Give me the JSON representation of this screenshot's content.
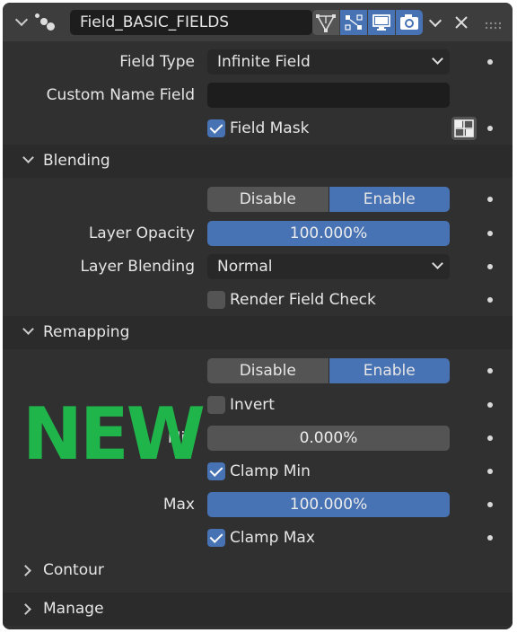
{
  "header": {
    "name_value": "Field_BASIC_FIELDS",
    "icons": [
      "modifier-dots-icon",
      "node-tree-icon",
      "edit-mode-icon",
      "realtime-monitor-icon",
      "camera-render-icon"
    ]
  },
  "rows": {
    "field_type_label": "Field Type",
    "field_type_value": "Infinite Field",
    "custom_name_label": "Custom Name Field",
    "custom_name_value": "",
    "field_mask_label": "Field Mask"
  },
  "blending": {
    "title": "Blending",
    "toggle": [
      "Disable",
      "Enable"
    ],
    "opacity_label": "Layer Opacity",
    "opacity_value": "100.000%",
    "blend_label": "Layer Blending",
    "blend_value": "Normal",
    "render_check_label": "Render Field Check"
  },
  "remapping": {
    "title": "Remapping",
    "toggle": [
      "Disable",
      "Enable"
    ],
    "invert_label": "Invert",
    "min_label": "Min",
    "min_value": "0.000%",
    "clamp_min_label": "Clamp Min",
    "max_label": "Max",
    "max_value": "100.000%",
    "clamp_max_label": "Clamp Max"
  },
  "collapsed": {
    "contour": "Contour",
    "manage": "Manage"
  },
  "badge": "NEW",
  "colors": {
    "accent": "#4772b3",
    "badge": "#1fb54a",
    "panel": "#303030"
  }
}
